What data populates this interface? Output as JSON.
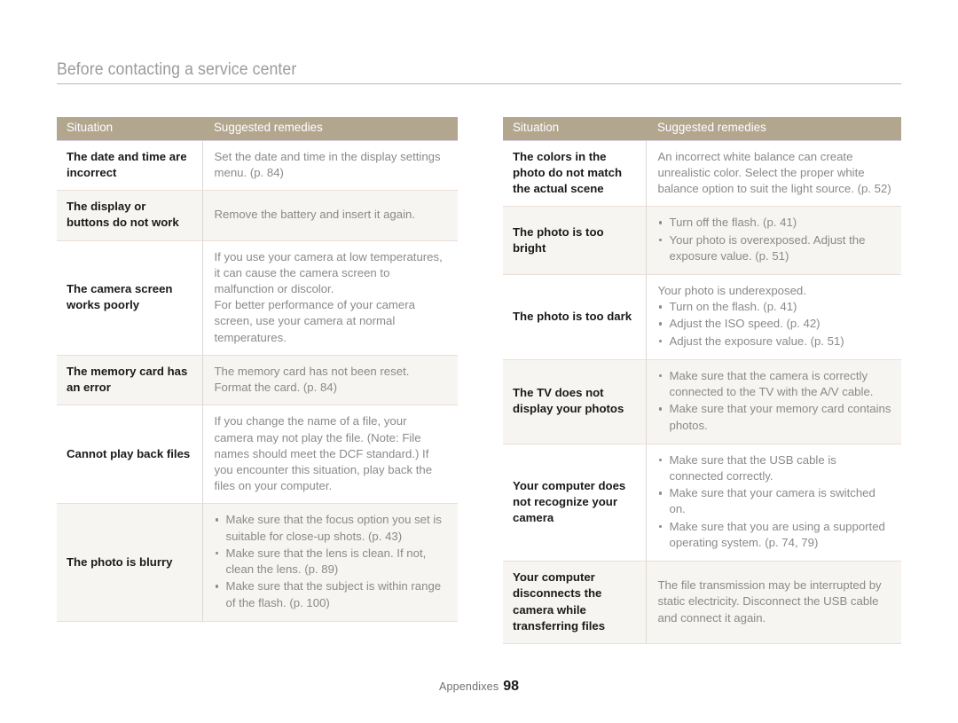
{
  "page": {
    "title": "Before contacting a service center",
    "footer_label": "Appendixes",
    "page_number": "98",
    "header_bg": "#b3a68f",
    "alt_row_bg": "#f7f5f1",
    "body_text_color": "#8a8a8a",
    "situation_text_color": "#1a1a1a"
  },
  "tables": [
    {
      "id": "table-left",
      "columns": [
        "Situation",
        "Suggested remedies"
      ],
      "rows": [
        {
          "situation": "The date and time are incorrect",
          "remedy_type": "paragraph",
          "remedy": "Set the date and time in the display settings menu. (p. 84)"
        },
        {
          "situation": "The display or buttons do not work",
          "remedy_type": "paragraph",
          "remedy": "Remove the battery and insert it again."
        },
        {
          "situation": "The camera screen works poorly",
          "remedy_type": "paragraph",
          "remedy": "If you use your camera at low temperatures, it can cause the camera screen to malfunction or discolor.\nFor better performance of your camera screen, use your camera at normal temperatures."
        },
        {
          "situation": "The memory card has an error",
          "remedy_type": "paragraph",
          "remedy": "The memory card has not been reset. Format the card. (p. 84)"
        },
        {
          "situation": "Cannot play back files",
          "remedy_type": "paragraph",
          "remedy": "If you change the name of a file, your camera may not play the file. (Note: File names should meet the DCF standard.) If you encounter this situation, play back the files on your computer."
        },
        {
          "situation": "The photo is blurry",
          "remedy_type": "list",
          "remedy_items": [
            "Make sure that the focus option you set is suitable for close-up shots. (p. 43)",
            "Make sure that the lens is clean. If not, clean the lens. (p. 89)",
            "Make sure that the subject is within range of the flash. (p. 100)"
          ]
        }
      ]
    },
    {
      "id": "table-right",
      "columns": [
        "Situation",
        "Suggested remedies"
      ],
      "rows": [
        {
          "situation": "The colors in the photo do not match the actual scene",
          "remedy_type": "paragraph",
          "remedy": "An incorrect white balance can create unrealistic color. Select the proper white balance option to suit the light source. (p. 52)"
        },
        {
          "situation": "The photo is too bright",
          "remedy_type": "list",
          "remedy_items": [
            "Turn off the flash. (p. 41)",
            "Your photo is overexposed. Adjust the exposure value. (p. 51)"
          ]
        },
        {
          "situation": "The photo is too dark",
          "remedy_type": "list",
          "remedy_lead": "Your photo is underexposed.",
          "remedy_items": [
            "Turn on the flash. (p. 41)",
            "Adjust the ISO speed. (p. 42)",
            "Adjust the exposure value. (p. 51)"
          ]
        },
        {
          "situation": "The TV does not display your photos",
          "remedy_type": "list",
          "remedy_items": [
            "Make sure that the camera is correctly connected to the TV with the A/V cable.",
            "Make sure that your memory card contains photos."
          ]
        },
        {
          "situation": "Your computer does not recognize your camera",
          "remedy_type": "list",
          "remedy_items": [
            "Make sure that the USB cable is connected correctly.",
            "Make sure that your camera is switched on.",
            "Make sure that you are using a supported operating system. (p. 74, 79)"
          ]
        },
        {
          "situation": "Your computer disconnects the camera while transferring files",
          "remedy_type": "paragraph",
          "remedy": "The file transmission may be interrupted by static electricity. Disconnect the USB cable and connect it again."
        }
      ]
    }
  ]
}
